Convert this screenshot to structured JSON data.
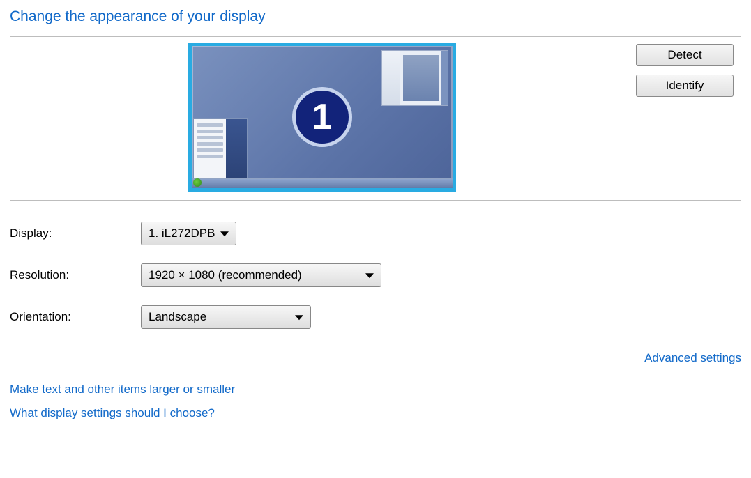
{
  "title": "Change the appearance of your display",
  "preview": {
    "monitor_number": "1",
    "buttons": {
      "detect": "Detect",
      "identify": "Identify"
    }
  },
  "settings": {
    "display_label": "Display:",
    "display_value": "1. iL272DPB",
    "resolution_label": "Resolution:",
    "resolution_value": "1920 × 1080 (recommended)",
    "orientation_label": "Orientation:",
    "orientation_value": "Landscape"
  },
  "links": {
    "advanced": "Advanced settings",
    "text_size": "Make text and other items larger or smaller",
    "help": "What display settings should I choose?"
  }
}
